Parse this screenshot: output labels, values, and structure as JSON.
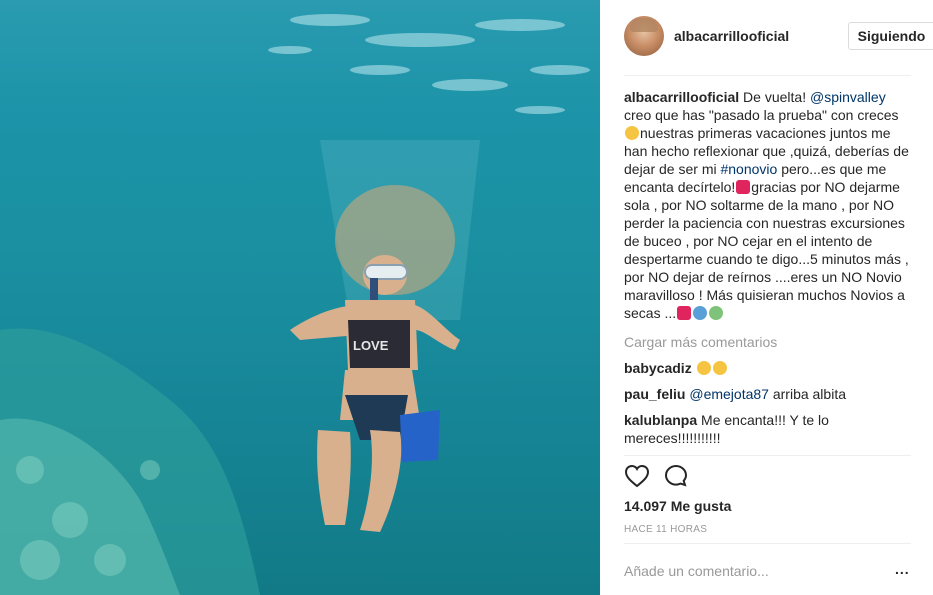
{
  "post": {
    "username": "albacarrillooficial",
    "follow_label": "Siguiendo",
    "caption": {
      "author": "albacarrillooficial",
      "part1": " De vuelta! ",
      "mention": "@spinvalley",
      "part2": " creo que has \"pasado la prueba\" con creces ",
      "part3": "nuestras primeras vacaciones juntos me han hecho reflexionar que ,quizá, deberías de dejar de ser mi ",
      "hashtag": "#nonovio",
      "part4": " pero...es que me encanta decírtelo!",
      "part5": "gracias por NO dejarme sola , por NO soltarme de la mano , por NO perder la paciencia con nuestras excursiones de buceo , por NO cejar en el intento de despertarme cuando te digo...5 minutos más , por NO dejar de reírnos ....eres un NO Novio maravilloso ! Más quisieran muchos Novios a secas ..."
    },
    "load_more": "Cargar más comentarios",
    "comments": [
      {
        "user": "babycadiz",
        "text": ""
      },
      {
        "user": "pau_feliu",
        "mention": "@emejota87",
        "text": " arriba albita"
      },
      {
        "user": "kalublanpa",
        "text": " Me encanta!!! Y te lo mereces!!!!!!!!!!!"
      }
    ],
    "likes": "14.097 Me gusta",
    "time": "HACE 11 HORAS",
    "add_comment_placeholder": "Añade un comentario...",
    "more_label": "...",
    "icons": [
      "heart-icon",
      "comment-icon"
    ],
    "colors": {
      "link": "#003569",
      "muted": "#999999",
      "water": "#1a8fa0"
    },
    "image_text": "LOVE"
  }
}
